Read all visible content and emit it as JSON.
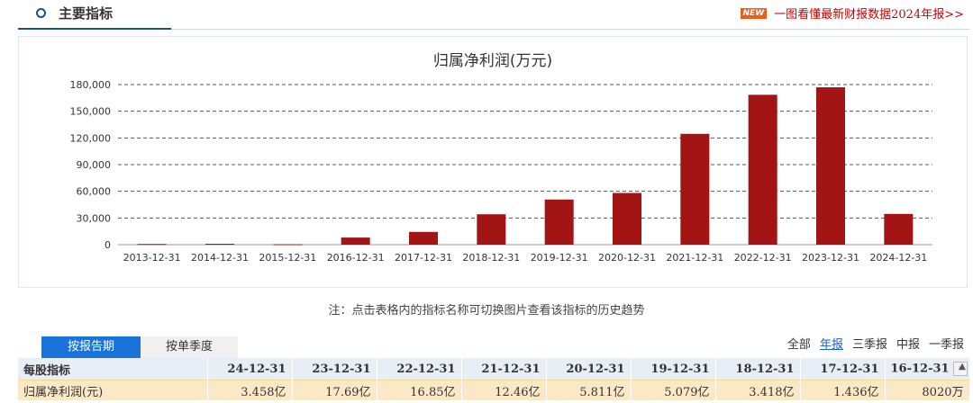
{
  "header": {
    "title": "主要指标",
    "new_badge": "NEW",
    "link_text": "一图看懂最新财报数据2024年报>>"
  },
  "chart_data": {
    "type": "bar",
    "title": "归属净利润(万元)",
    "categories": [
      "2013-12-31",
      "2014-12-31",
      "2015-12-31",
      "2016-12-31",
      "2017-12-31",
      "2018-12-31",
      "2019-12-31",
      "2020-12-31",
      "2021-12-31",
      "2022-12-31",
      "2023-12-31",
      "2024-12-31"
    ],
    "values": [
      800,
      1000,
      500,
      8020,
      14360,
      34180,
      50790,
      58110,
      124600,
      168500,
      176900,
      34580
    ],
    "y_ticks": [
      "0",
      "30,000",
      "60,000",
      "90,000",
      "120,000",
      "150,000",
      "180,000"
    ],
    "ylim": [
      0,
      180000
    ],
    "bar_color": "#a31515",
    "grid": true
  },
  "note": "注：点击表格内的指标名称可切换图片查看该指标的历史趋势",
  "tabs": [
    "按报告期",
    "按单季度"
  ],
  "filters": [
    "全部",
    "年报",
    "三季报",
    "中报",
    "一季报"
  ],
  "table": {
    "headers": [
      "每股指标",
      "24-12-31",
      "23-12-31",
      "22-12-31",
      "21-12-31",
      "20-12-31",
      "19-12-31",
      "18-12-31",
      "17-12-31",
      "16-12-31"
    ],
    "rows": [
      [
        "归属净利润(元)",
        "3.458亿",
        "17.69亿",
        "16.85亿",
        "12.46亿",
        "5.811亿",
        "5.079亿",
        "3.418亿",
        "1.436亿",
        "8020万"
      ]
    ]
  },
  "colors": {
    "accent": "#1a73d8",
    "bar": "#a31515",
    "highlight_row": "#fbe9c6"
  }
}
